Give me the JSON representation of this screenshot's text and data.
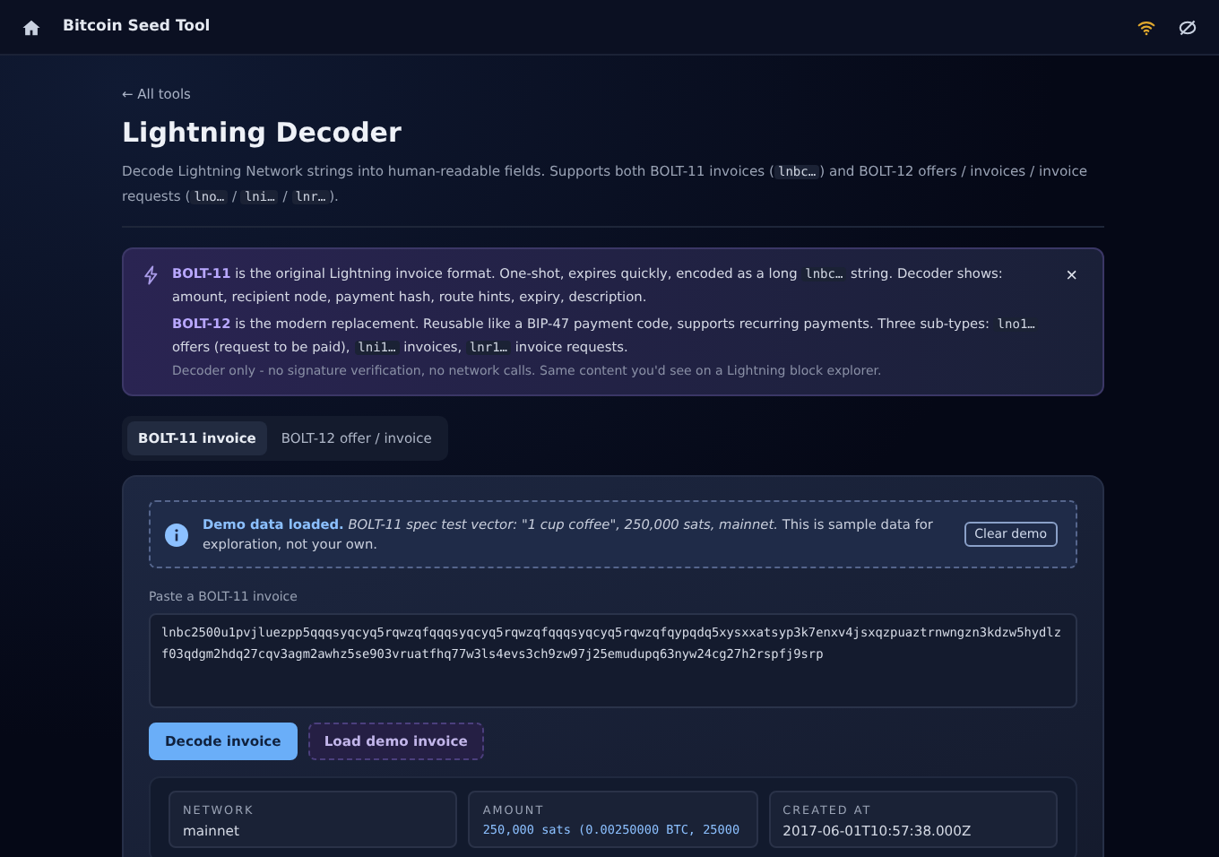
{
  "header": {
    "title": "Bitcoin Seed Tool"
  },
  "back_link": "← All tools",
  "title": "Lightning Decoder",
  "description": [
    {
      "kind": "text",
      "text": "Decode Lightning Network strings into human-readable fields. Supports both BOLT-11 invoices ("
    },
    {
      "kind": "code",
      "text": "lnbc…"
    },
    {
      "kind": "text",
      "text": ") and BOLT-12 offers / invoices / invoice requests ("
    },
    {
      "kind": "code",
      "text": "lno…"
    },
    {
      "kind": "text",
      "text": " / "
    },
    {
      "kind": "code",
      "text": "lni…"
    },
    {
      "kind": "text",
      "text": " / "
    },
    {
      "kind": "code",
      "text": "lnr…"
    },
    {
      "kind": "text",
      "text": ")."
    }
  ],
  "callout": {
    "close": "×",
    "paragraphs": [
      [
        {
          "kind": "strong",
          "text": "BOLT-11"
        },
        {
          "kind": "text",
          "text": " is the original Lightning invoice format. One-shot, expires quickly, encoded as a long "
        },
        {
          "kind": "code",
          "text": "lnbc…"
        },
        {
          "kind": "text",
          "text": " string. Decoder shows: amount, recipient node, payment hash, route hints, expiry, description."
        }
      ],
      [
        {
          "kind": "strong",
          "text": "BOLT-12"
        },
        {
          "kind": "text",
          "text": " is the modern replacement. Reusable like a BIP-47 payment code, supports recurring payments. Three sub-types: "
        },
        {
          "kind": "code",
          "text": "lno1…"
        },
        {
          "kind": "text",
          "text": " offers (request to be paid), "
        },
        {
          "kind": "code",
          "text": "lni1…"
        },
        {
          "kind": "text",
          "text": " invoices, "
        },
        {
          "kind": "code",
          "text": "lnr1…"
        },
        {
          "kind": "text",
          "text": " invoice requests."
        }
      ]
    ],
    "note": "Decoder only - no signature verification, no network calls. Same content you'd see on a Lightning block explorer."
  },
  "tabs": [
    {
      "label": "BOLT-11 invoice",
      "selected": true
    },
    {
      "label": "BOLT-12 offer / invoice",
      "selected": false
    }
  ],
  "demo_notice": {
    "text": "**Demo data loaded.** *BOLT-11 spec test vector: \"1 cup coffee\", 250,000 sats, mainnet.* This is sample data for exploration, not your own.",
    "button": "Clear demo"
  },
  "invoice_field": {
    "label": "Paste a BOLT-11 invoice",
    "value": "lnbc2500u1pvjluezpp5qqqsyqcyq5rqwzqfqqqsyqcyq5rqwzqfqqqsyqcyq5rqwzqfqypqdq5xysxxatsyp3k7enxv4jsxqzpuaztrnwngzn3kdzw5hydlzf03qdgm2hdq27cqv3agm2awhz5se903vruatfhq77w3ls4evs3ch9zw97j25emudupq63nyw24cg27h2rspfj9srp"
  },
  "buttons": [
    {
      "label": "Decode invoice",
      "kind": "primary"
    },
    {
      "label": "Load demo invoice",
      "kind": "secondary"
    }
  ],
  "fields": [
    {
      "label": "NETWORK",
      "value": "mainnet",
      "kind": "text"
    },
    {
      "label": "AMOUNT",
      "value": "250,000 sats (0.00250000 BTC, 25000",
      "kind": "mono"
    },
    {
      "label": "CREATED AT",
      "value": "2017-06-01T10:57:38.000Z",
      "kind": "text"
    }
  ]
}
